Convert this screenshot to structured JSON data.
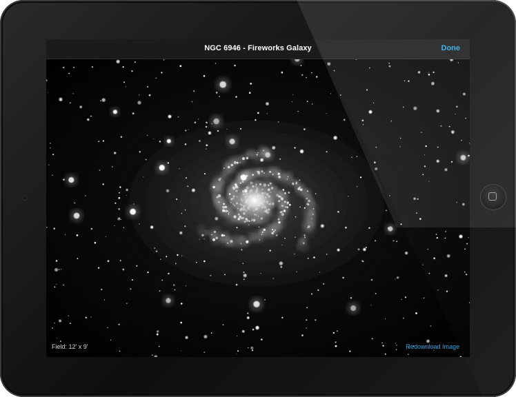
{
  "viewer": {
    "title": "NGC 6946 - Fireworks Galaxy",
    "done_label": "Done",
    "field_text": "Field: 12' x 9'",
    "redownload_label": "Redownload Image"
  },
  "image": {
    "subject": "spiral-galaxy-with-stars",
    "palette": "grayscale"
  },
  "icons": {
    "home_button": "home-square-icon",
    "camera": "front-camera-icon"
  },
  "colors": {
    "accent": "#2fa8e8",
    "navbar": "#1c1c1c",
    "bezel": "#141414"
  }
}
